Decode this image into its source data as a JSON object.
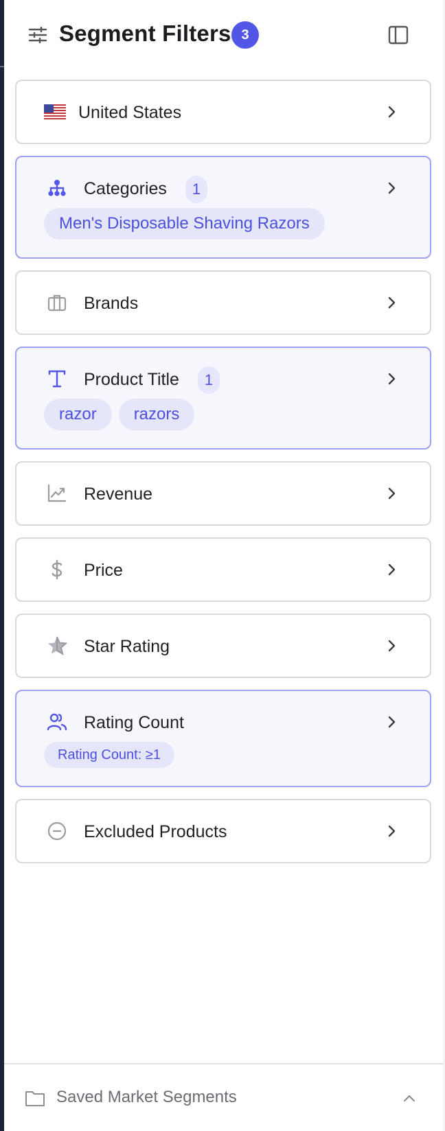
{
  "header": {
    "title": "Segment Filters",
    "badge_count": "3",
    "icons": {
      "filter": "sliders-icon",
      "collapse": "sidebar-toggle-icon"
    }
  },
  "filters": [
    {
      "label": "United States",
      "icon": "us-flag-icon",
      "active": false,
      "count": null,
      "chips": []
    },
    {
      "label": "Categories",
      "icon": "hierarchy-icon",
      "active": true,
      "count": "1",
      "chips": [
        "Men's Disposable Shaving Razors"
      ]
    },
    {
      "label": "Brands",
      "icon": "briefcase-icon",
      "active": false,
      "count": null,
      "chips": []
    },
    {
      "label": "Product Title",
      "icon": "text-icon",
      "active": true,
      "count": "1",
      "chips": [
        "razor",
        "razors"
      ]
    },
    {
      "label": "Revenue",
      "icon": "trend-chart-icon",
      "active": false,
      "count": null,
      "chips": []
    },
    {
      "label": "Price",
      "icon": "dollar-icon",
      "active": false,
      "count": null,
      "chips": []
    },
    {
      "label": "Star Rating",
      "icon": "star-icon",
      "active": false,
      "count": null,
      "chips": []
    },
    {
      "label": "Rating Count",
      "icon": "users-icon",
      "active": true,
      "count": null,
      "chips": [
        "Rating Count: ≥1"
      ]
    },
    {
      "label": "Excluded Products",
      "icon": "minus-circle-icon",
      "active": false,
      "count": null,
      "chips": []
    }
  ],
  "footer": {
    "label": "Saved Market Segments",
    "icon": "folder-icon",
    "chevron": "chevron-up-icon"
  },
  "colors": {
    "accent": "#5156e6",
    "active_border": "#9ea1ef",
    "active_bg": "#f6f6fd",
    "chip_bg": "#e5e6fa",
    "chip_text": "#4b50db",
    "inactive_icon": "#9a9ba1"
  }
}
